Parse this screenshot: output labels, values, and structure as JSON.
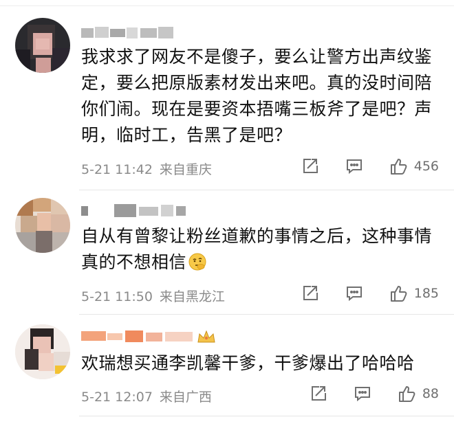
{
  "comments": [
    {
      "text": "我求求了网友不是傻子，要么让警方出声纹鉴定，要么把原版素材发出来吧。真的没时间陪你们闹。现在是要资本捂嘴三板斧了是吧？声明，临时工，告黑了是吧？",
      "date": "5-21 11:42",
      "location": "来自重庆",
      "likes": "456"
    },
    {
      "text": "自从有曾黎让粉丝道歉的事情之后，这种事情真的不想相信",
      "date": "5-21 11:50",
      "location": "来自黑龙江",
      "likes": "185",
      "emoji_icon": "thinking-face-emoji"
    },
    {
      "text": "欢瑞想买通李凯馨干爹，干爹爆出了哈哈哈",
      "date": "5-21 12:07",
      "location": "来自广西",
      "likes": "88",
      "badge_icon": "crown-badge-icon"
    }
  ],
  "icons": {
    "share": "share-icon",
    "reply": "comment-icon",
    "like": "thumbs-up-icon"
  },
  "colors": {
    "text": "#111111",
    "meta": "#8a8a8a",
    "icon": "#6f6f6f",
    "divider": "#e6e6e6"
  }
}
